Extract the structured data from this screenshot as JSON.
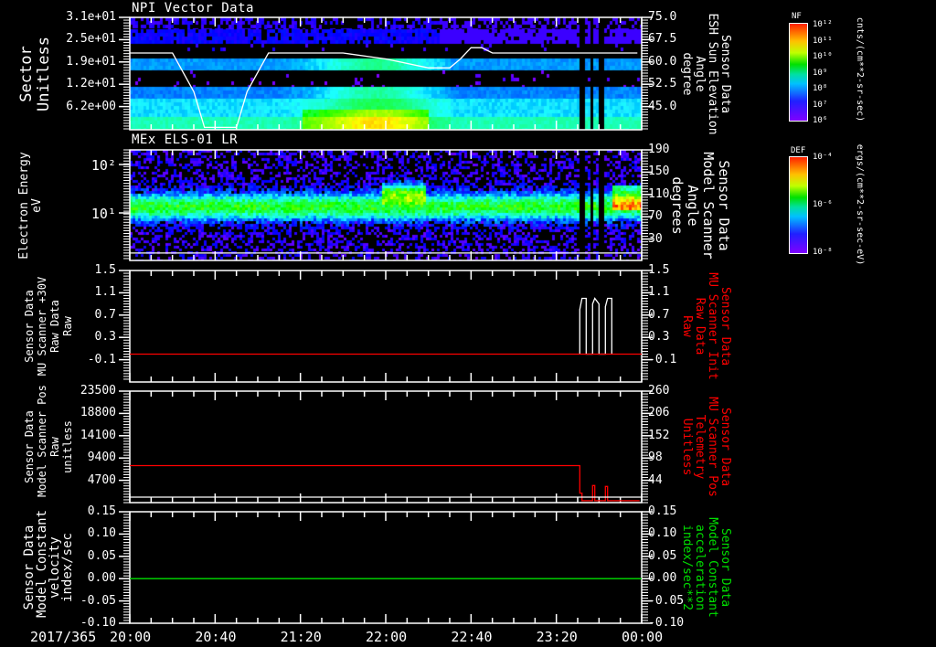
{
  "chart_data": [
    {
      "type": "heatmap",
      "title": "NPI Vector Data",
      "ylabel": "Sector\nUnitless",
      "yticks": [
        "3.1e+01",
        "2.5e+01",
        "1.9e+01",
        "1.2e+01",
        "6.2e+00"
      ],
      "ylabel_right": "Sensor Data\nESH Sun Elevation\nAngle\ndegree",
      "yticks_right": [
        "75.0",
        "67.5",
        "60.0",
        "52.5",
        "45.0"
      ],
      "ylim_right": [
        37.3,
        75.0
      ],
      "colorbar": {
        "label": "NF",
        "ticks": [
          "10¹²",
          "10¹¹",
          "10¹⁰",
          "10⁹",
          "10⁸",
          "10⁷",
          "10⁶"
        ],
        "units": "cnts/(cm**2-sr-sec)"
      },
      "overlay_line": {
        "axis": "right",
        "color": "#ffffff",
        "x": [
          "20:00",
          "20:20",
          "20:30",
          "20:35",
          "20:50",
          "20:55",
          "21:05",
          "21:40",
          "22:00",
          "22:20",
          "22:30",
          "22:35",
          "22:40",
          "22:45",
          "22:50",
          "23:58"
        ],
        "y": [
          63,
          63,
          50,
          38,
          38,
          50,
          63,
          63,
          61,
          58,
          58,
          61,
          64.8,
          64.8,
          63,
          63
        ]
      }
    },
    {
      "type": "heatmap",
      "title": "MEx ELS-01 LR",
      "ylabel": "Electron Energy\neV",
      "yscale": "log",
      "yticks": [
        "10²",
        "10¹"
      ],
      "ylim": [
        1,
        200
      ],
      "ylabel_right": "Sensor Data\nModel Scanner\nAngle\ndegrees",
      "yticks_right": [
        "190",
        "150",
        "110",
        "70",
        "30"
      ],
      "colorbar": {
        "label": "DEF",
        "ticks": [
          "10⁻⁴",
          "10⁻⁶",
          "10⁻⁸"
        ],
        "units": "ergs/(cm**2-sr-sec-eV)"
      },
      "overlay_line": {
        "axis": "right",
        "color": "#ffffff",
        "x": [
          "20:00",
          "00:00"
        ],
        "y": [
          5,
          5
        ]
      }
    },
    {
      "type": "line",
      "ylabel": "Sensor Data\nMU Scanner +30V\nRaw Data\nRaw",
      "yticks": [
        "1.5",
        "1.1",
        "0.7",
        "0.3",
        "-0.1"
      ],
      "ylim": [
        -0.49,
        1.5
      ],
      "ylabel_right": "Sensor Data\nMU Scanner Init\nRaw Data\nRaw",
      "yticks_right": [
        "1.5",
        "1.1",
        "0.7",
        "0.3",
        "-0.1"
      ],
      "series": [
        {
          "color": "#ffffff",
          "x": [
            "23:31",
            "23:31",
            "23:32",
            "23:34",
            "23:34",
            "23:37",
            "23:37",
            "23:38",
            "23:40",
            "23:40",
            "23:43",
            "23:43",
            "23:44",
            "23:46",
            "23:46"
          ],
          "y": [
            0,
            0.8,
            1.0,
            1.0,
            0,
            0,
            0.9,
            1.0,
            0.9,
            0,
            0,
            0.85,
            1.0,
            1.0,
            0
          ]
        },
        {
          "color": "#ff0000",
          "x": [
            "20:00",
            "00:00"
          ],
          "y": [
            0,
            0
          ]
        }
      ]
    },
    {
      "type": "line",
      "ylabel": "Sensor Data\nModel Scanner Pos\nRaw\nunitless",
      "yticks": [
        "23500",
        "18800",
        "14100",
        "9400",
        "4700"
      ],
      "ylabel_right": "Sensor Data\nMU Scanner Pos\nTelemetry\nUnitless",
      "yticks_right": [
        "260",
        "206",
        "152",
        "98",
        "44"
      ],
      "ylim": [
        0,
        23500
      ],
      "series": [
        {
          "color": "#ff0000",
          "x": [
            "20:00",
            "23:31",
            "23:31",
            "23:32",
            "23:32",
            "23:37",
            "23:37",
            "23:38",
            "23:38",
            "23:43",
            "23:43",
            "23:44",
            "23:44",
            "23:59"
          ],
          "y": [
            7800,
            7800,
            2000,
            2000,
            400,
            400,
            3600,
            3600,
            400,
            400,
            3400,
            3400,
            400,
            400
          ]
        },
        {
          "color": "#ffffff",
          "x": [
            "20:00",
            "00:00"
          ],
          "y": [
            1150,
            1150
          ]
        }
      ]
    },
    {
      "type": "line",
      "ylabel": "Sensor Data\nModel Constant\nvelocity\nindex/sec",
      "yticks": [
        "0.15",
        "0.10",
        "0.05",
        "0.00",
        "-0.05",
        "-0.10"
      ],
      "ylim": [
        -0.1,
        0.15
      ],
      "ylabel_right": "Sensor Data\nModel Constant\nacceleration\nindex/sec**2",
      "yticks_right": [
        "0.15",
        "0.10",
        "0.05",
        "0.00",
        "-0.05",
        "-0.10"
      ],
      "series": [
        {
          "color": "#00e000",
          "x": [
            "20:00",
            "00:00"
          ],
          "y": [
            0,
            0
          ]
        }
      ]
    }
  ],
  "xaxis": {
    "date": "2017/365",
    "ticks": [
      "20:00",
      "20:40",
      "21:20",
      "22:00",
      "22:40",
      "23:20",
      "00:00"
    ]
  }
}
